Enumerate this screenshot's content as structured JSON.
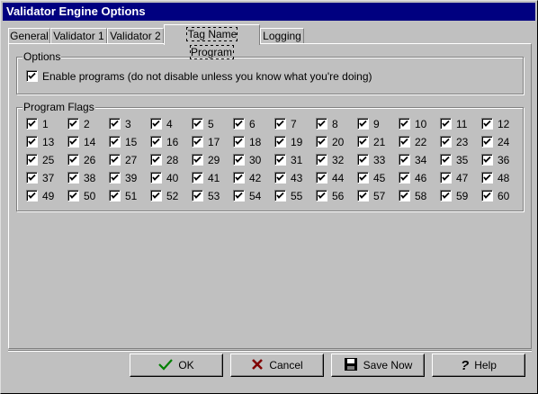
{
  "window": {
    "title": "Validator Engine Options"
  },
  "tabs": [
    {
      "label": "General"
    },
    {
      "label": "Validator 1"
    },
    {
      "label": "Validator 2"
    },
    {
      "label": "Tag Name Program"
    },
    {
      "label": "Logging"
    }
  ],
  "active_tab": "Tag Name Program",
  "options_group": {
    "label": "Options",
    "enable_programs": {
      "label": "Enable programs (do not disable unless you know what you're doing)",
      "checked": true
    }
  },
  "flags_group": {
    "label": "Program Flags",
    "flags": [
      "1",
      "2",
      "3",
      "4",
      "5",
      "6",
      "7",
      "8",
      "9",
      "10",
      "11",
      "12",
      "13",
      "14",
      "15",
      "16",
      "17",
      "18",
      "19",
      "20",
      "21",
      "22",
      "23",
      "24",
      "25",
      "26",
      "27",
      "28",
      "29",
      "30",
      "31",
      "32",
      "33",
      "34",
      "35",
      "36",
      "37",
      "38",
      "39",
      "40",
      "41",
      "42",
      "43",
      "44",
      "45",
      "46",
      "47",
      "48",
      "49",
      "50",
      "51",
      "52",
      "53",
      "54",
      "55",
      "56",
      "57",
      "58",
      "59",
      "60"
    ],
    "all_checked": true
  },
  "buttons": {
    "ok": "OK",
    "cancel": "Cancel",
    "save_now": "Save Now",
    "help": "Help"
  }
}
